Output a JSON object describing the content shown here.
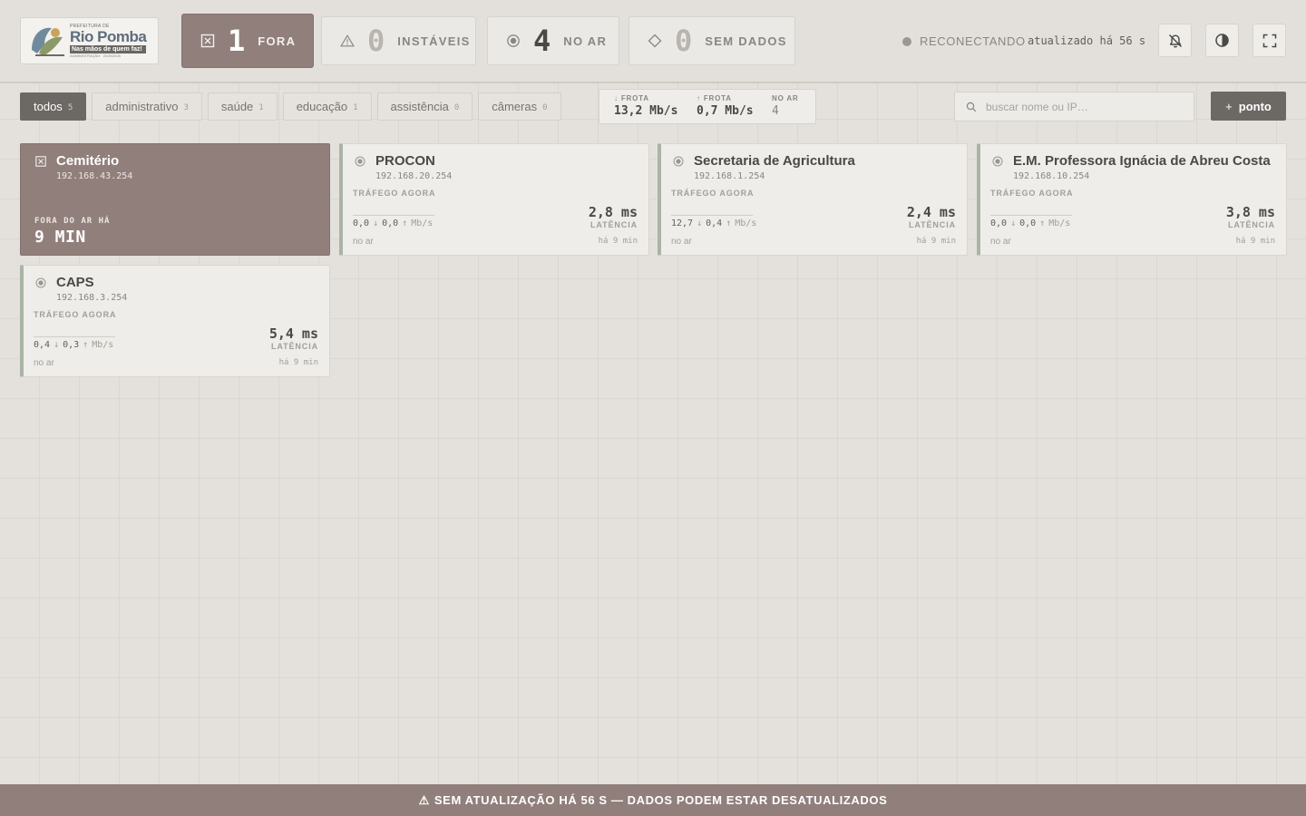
{
  "logo": {
    "small": "PREFEITURA DE",
    "main": "Rio Pomba",
    "tagline": "Nas mãos de quem faz!",
    "admin": "ADMINISTRAÇÃO · 2025/2028"
  },
  "stats": {
    "down": {
      "count": "1",
      "label": "FORA",
      "icon": "x-square-icon"
    },
    "unstable": {
      "count": "0",
      "label": "INSTÁVEIS",
      "icon": "warning-icon"
    },
    "online": {
      "count": "4",
      "label": "NO AR",
      "icon": "radio-icon"
    },
    "nodata": {
      "count": "0",
      "label": "SEM DADOS",
      "icon": "diamond-icon"
    }
  },
  "connection": {
    "status": "RECONECTANDO",
    "updated": "atualizado há 56 s"
  },
  "filters": [
    {
      "label": "todos",
      "count": "5"
    },
    {
      "label": "administrativo",
      "count": "3"
    },
    {
      "label": "saúde",
      "count": "1"
    },
    {
      "label": "educação",
      "count": "1"
    },
    {
      "label": "assistência",
      "count": "0"
    },
    {
      "label": "câmeras",
      "count": "0"
    }
  ],
  "fleet": {
    "down_label": "↓ FROTA",
    "down_value": "13,2 Mb/s",
    "up_label": "↑ FROTA",
    "up_value": "0,7 Mb/s",
    "online_label": "NO AR",
    "online_value": "4"
  },
  "search": {
    "placeholder": "buscar nome ou IP…",
    "value": ""
  },
  "add_button": {
    "plus": "+",
    "label": "ponto"
  },
  "cards": [
    {
      "state": "down",
      "name": "Cemitério",
      "ip": "192.168.43.254",
      "down_label": "FORA DO AR HÁ",
      "down_value": "9 MIN"
    },
    {
      "state": "up",
      "name": "PROCON",
      "ip": "192.168.20.254",
      "traffic_label": "TRÁFEGO AGORA",
      "rx": "0,0",
      "tx": "0,0",
      "unit": "Mb/s",
      "latency": "2,8 ms",
      "latency_label": "LATÊNCIA",
      "status": "no ar",
      "since": "há 9 min"
    },
    {
      "state": "up",
      "name": "Secretaria de Agricultura",
      "ip": "192.168.1.254",
      "traffic_label": "TRÁFEGO AGORA",
      "rx": "12,7",
      "tx": "0,4",
      "unit": "Mb/s",
      "latency": "2,4 ms",
      "latency_label": "LATÊNCIA",
      "status": "no ar",
      "since": "há 9 min"
    },
    {
      "state": "up",
      "name": "E.M. Professora Ignácia de Abreu Costa",
      "ip": "192.168.10.254",
      "traffic_label": "TRÁFEGO AGORA",
      "rx": "0,0",
      "tx": "0,0",
      "unit": "Mb/s",
      "latency": "3,8 ms",
      "latency_label": "LATÊNCIA",
      "status": "no ar",
      "since": "há 9 min"
    },
    {
      "state": "up",
      "name": "CAPS",
      "ip": "192.168.3.254",
      "traffic_label": "TRÁFEGO AGORA",
      "rx": "0,4",
      "tx": "0,3",
      "unit": "Mb/s",
      "latency": "5,4 ms",
      "latency_label": "LATÊNCIA",
      "status": "no ar",
      "since": "há 9 min"
    }
  ],
  "banner": {
    "icon": "⚠",
    "text": "SEM ATUALIZAÇÃO HÁ 56 S — DADOS PODEM ESTAR DESATUALIZADOS"
  },
  "colors": {
    "down": "#917f7c",
    "accent_dark": "#6c6864",
    "online_border": "#aab4a4",
    "background": "#e4e1dc"
  }
}
